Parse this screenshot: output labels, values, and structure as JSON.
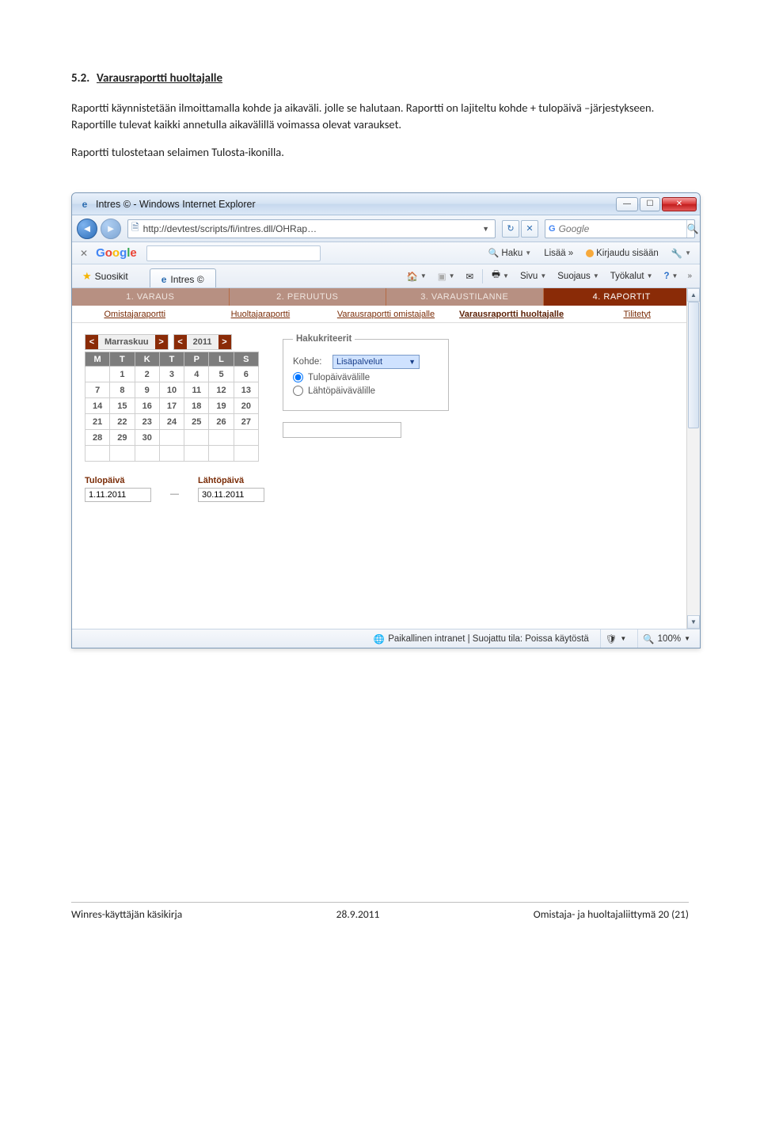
{
  "doc": {
    "section_no": "5.2.",
    "section_title": "Varausraportti huoltajalle",
    "para1": "Raportti käynnistetään ilmoittamalla kohde ja aikaväli. jolle se halutaan. Raportti on lajiteltu kohde + tulopäivä –järjestykseen. Raportille tulevat kaikki annetulla aikavälillä voimassa olevat varaukset.",
    "para2": "Raportti tulostetaan selaimen Tulosta-ikonilla."
  },
  "window": {
    "title": "Intres © - Windows Internet Explorer",
    "url": "http://devtest/scripts/fi/intres.dll/OHRap…",
    "search_placeholder": "Google",
    "favorites_label": "Suosikit",
    "tab_label": "Intres ©",
    "cmd": {
      "sivu": "Sivu",
      "suojaus": "Suojaus",
      "tyokalut": "Työkalut"
    },
    "google_bar": {
      "haku": "Haku",
      "lisaa": "Lisää",
      "kirjaudu": "Kirjaudu sisään"
    },
    "status": {
      "zone": "Paikallinen intranet | Suojattu tila: Poissa käytöstä",
      "zoom": "100%"
    }
  },
  "app": {
    "main_tabs": [
      "1. VARAUS",
      "2. PERUUTUS",
      "3. VARAUSTILANNE",
      "4. RAPORTIT"
    ],
    "active_main_tab": 3,
    "sub_tabs": [
      "Omistajaraportti",
      "Huoltajaraportti",
      "Varausraportti omistajalle",
      "Varausraportti huoltajalle",
      "Tilitetyt"
    ],
    "calendar": {
      "month": "Marraskuu",
      "year": "2011",
      "weekdays": [
        "M",
        "T",
        "K",
        "T",
        "P",
        "L",
        "S"
      ],
      "rows": [
        [
          "",
          "1",
          "2",
          "3",
          "4",
          "5",
          "6"
        ],
        [
          "7",
          "8",
          "9",
          "10",
          "11",
          "12",
          "13"
        ],
        [
          "14",
          "15",
          "16",
          "17",
          "18",
          "19",
          "20"
        ],
        [
          "21",
          "22",
          "23",
          "24",
          "25",
          "26",
          "27"
        ],
        [
          "28",
          "29",
          "30",
          "",
          "",
          "",
          ""
        ],
        [
          "",
          "",
          "",
          "",
          "",
          "",
          ""
        ]
      ]
    },
    "dates": {
      "tulo_label": "Tulopäivä",
      "lahto_label": "Lähtöpäivä",
      "tulo": "1.11.2011",
      "lahto": "30.11.2011"
    },
    "criteria": {
      "legend": "Hakukriteerit",
      "kohde_label": "Kohde:",
      "kohde_value": "Lisäpalvelut",
      "radio1": "Tulopäivävälille",
      "radio2": "Lähtöpäivävälille"
    }
  },
  "footer": {
    "left": "Winres-käyttäjän käsikirja",
    "center": "28.9.2011",
    "right": "Omistaja- ja huoltajaliittymä 20 (21)"
  }
}
